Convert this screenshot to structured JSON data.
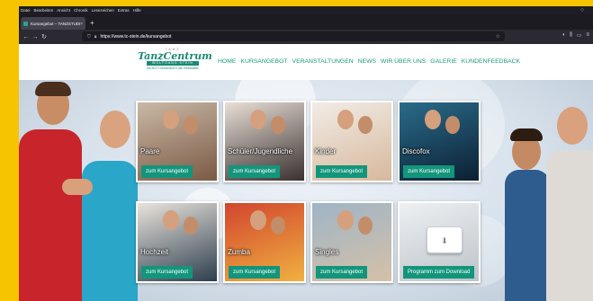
{
  "browser": {
    "menu": [
      "Datei",
      "Bearbeiten",
      "Ansicht",
      "Chronik",
      "Lesezeichen",
      "Extras",
      "Hilfe"
    ],
    "tab_title": "Kursangebot – TANZSTUDIO ELL",
    "tab_close": "×",
    "new_tab": "+",
    "url": "https://www.tc-stein.de/kursangebot",
    "nav_icons": [
      "back-icon",
      "forward-icon",
      "reload-icon"
    ]
  },
  "logo": {
    "top_text": "TANZ",
    "main_text": "TanzCentrum",
    "bar_text": "WOLFGANG STEIN",
    "sub_text": "Die ADTV-Tanzschule in den Elbestädten"
  },
  "nav": [
    "HOME",
    "KURSANGEBOT",
    "VERANSTALTUNGEN",
    "NEWS",
    "WIR ÜBER UNS",
    "GALERIE",
    "KUNDENFEEDBACK"
  ],
  "courses": [
    {
      "label": "Paare",
      "button": "zum Kursangebot",
      "colors": [
        "#c9b8a6",
        "#7a5a44"
      ]
    },
    {
      "label": "Schüler/Jugendliche",
      "button": "zum Kursangebot",
      "colors": [
        "#e8dfd6",
        "#3a3030"
      ]
    },
    {
      "label": "Kinder",
      "button": "zum Kursangebot",
      "colors": [
        "#f1ece6",
        "#d7b89c"
      ]
    },
    {
      "label": "Discofox",
      "button": "zum Kursangebot",
      "colors": [
        "#2a6c8a",
        "#0c1f33"
      ]
    },
    {
      "label": "Hochzeit",
      "button": "zum Kursangebot",
      "colors": [
        "#e9e4dc",
        "#2e3e4e"
      ]
    },
    {
      "label": "Zumba",
      "button": "zum Kursangebot",
      "colors": [
        "#d2452e",
        "#f0b040"
      ]
    },
    {
      "label": "Singles",
      "button": "zum Kursangebot",
      "colors": [
        "#9fb4c6",
        "#d4c1a7"
      ]
    },
    {
      "label": "",
      "button": "Programm zum Download",
      "colors": [
        "#eef0f2",
        "#bcc3c9"
      ]
    }
  ]
}
